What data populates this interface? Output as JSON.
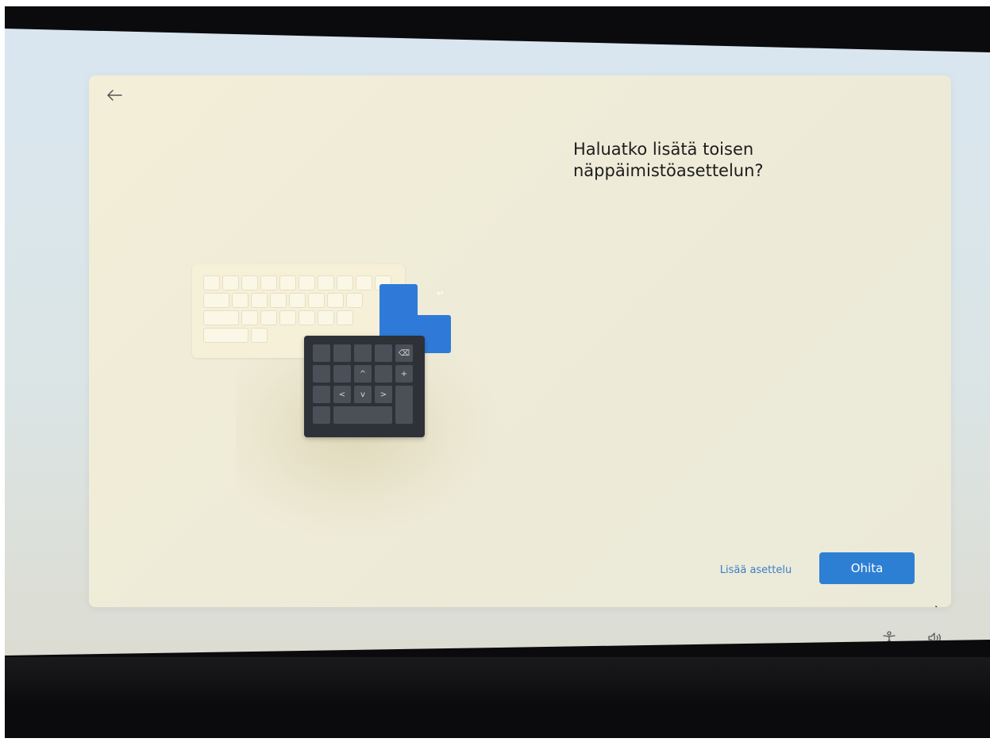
{
  "dialog": {
    "title": "Haluatko lisätä toisen näppäimistöasettelun?",
    "back_icon": "arrow-left-icon"
  },
  "actions": {
    "add_layout_label": "Lisää asettelu",
    "skip_label": "Ohita"
  },
  "system_tray": {
    "accessibility_icon": "accessibility-icon",
    "volume_icon": "volume-icon"
  },
  "illustration": {
    "numpad_keys": [
      "⌫",
      "^",
      "+",
      "<",
      "v",
      ">"
    ]
  },
  "colors": {
    "accent": "#2d7fd4",
    "link": "#3a7fc9",
    "dialog_bg": "#eeebd8",
    "numpad": "#2e3138"
  }
}
